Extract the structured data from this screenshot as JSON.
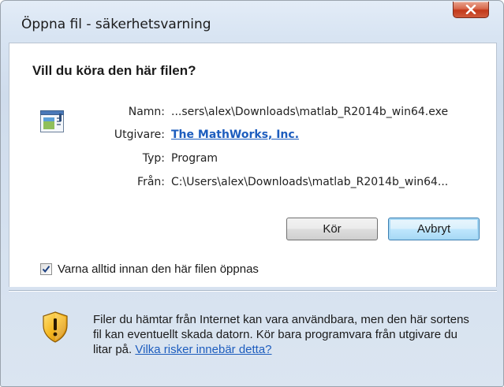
{
  "window": {
    "title": "Öppna fil - säkerhetsvarning"
  },
  "dialog": {
    "heading": "Vill du köra den här filen?",
    "fields": [
      {
        "label": "Namn:",
        "value": "...sers\\alex\\Downloads\\matlab_R2014b_win64.exe",
        "is_link": false
      },
      {
        "label": "Utgivare:",
        "value": "The MathWorks, Inc.",
        "is_link": true
      },
      {
        "label": "Typ:",
        "value": "Program",
        "is_link": false
      },
      {
        "label": "Från:",
        "value": "C:\\Users\\alex\\Downloads\\matlab_R2014b_win64...",
        "is_link": false
      }
    ],
    "buttons": {
      "run": "Kör",
      "cancel": "Avbryt"
    },
    "checkbox": {
      "label": "Varna alltid innan den här filen öppnas",
      "checked": true
    },
    "warning": {
      "text": "Filer du hämtar från Internet kan vara användbara, men den här sortens fil kan eventuellt skada datorn. Kör bara programvara från utgivare du litar på.",
      "link": "Vilka risker innebär detta?"
    }
  },
  "icons": {
    "close": "close-icon",
    "file": "application-file-icon",
    "shield": "security-shield-icon",
    "check": "checkmark-icon"
  },
  "colors": {
    "link": "#1d5dbe",
    "close_button": "#c2381a",
    "default_button_border": "#3c7fb1"
  }
}
